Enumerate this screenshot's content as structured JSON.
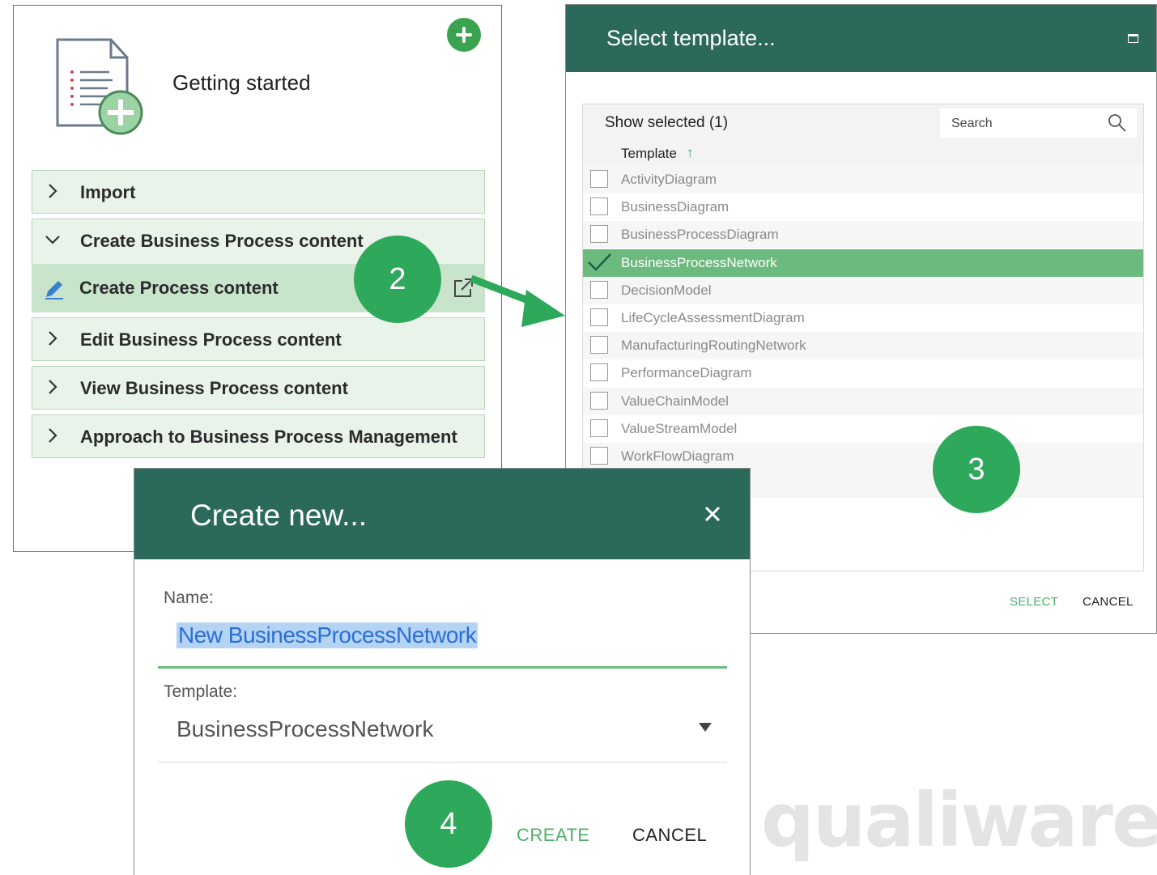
{
  "getting_started": {
    "title": "Getting started",
    "sections": [
      {
        "label": "Import",
        "expanded": false
      },
      {
        "label": "Create Business Process content",
        "expanded": true,
        "children": [
          {
            "label": "Create Process content"
          }
        ]
      },
      {
        "label": "Edit Business Process content",
        "expanded": false
      },
      {
        "label": "View Business Process content",
        "expanded": false
      },
      {
        "label": "Approach to Business Process Management",
        "expanded": false
      }
    ]
  },
  "steps": {
    "two": "2",
    "three": "3",
    "four": "4"
  },
  "select_template": {
    "title": "Select template...",
    "show_selected": "Show selected (1)",
    "search_placeholder": "Search",
    "column_header": "Template",
    "templates": [
      {
        "label": "ActivityDiagram",
        "selected": false
      },
      {
        "label": "BusinessDiagram",
        "selected": false
      },
      {
        "label": "BusinessProcessDiagram",
        "selected": false
      },
      {
        "label": "BusinessProcessNetwork",
        "selected": true
      },
      {
        "label": "DecisionModel",
        "selected": false
      },
      {
        "label": "LifeCycleAssessmentDiagram",
        "selected": false
      },
      {
        "label": "ManufacturingRoutingNetwork",
        "selected": false
      },
      {
        "label": "PerformanceDiagram",
        "selected": false
      },
      {
        "label": "ValueChainModel",
        "selected": false
      },
      {
        "label": "ValueStreamModel",
        "selected": false
      },
      {
        "label": "WorkFlowDiagram",
        "selected": false
      }
    ],
    "select_label": "SELECT",
    "cancel_label": "CANCEL"
  },
  "create_new": {
    "title": "Create new...",
    "name_label": "Name:",
    "name_value": "New BusinessProcessNetwork",
    "template_label": "Template:",
    "template_value": "BusinessProcessNetwork",
    "create_label": "CREATE",
    "cancel_label": "CANCEL"
  },
  "watermark": "qualiware",
  "colors": {
    "header": "#2b6a5a",
    "accent_green": "#2ea85a",
    "selected_row": "#6cba7d",
    "expander_bg": "#e9f3ea"
  }
}
